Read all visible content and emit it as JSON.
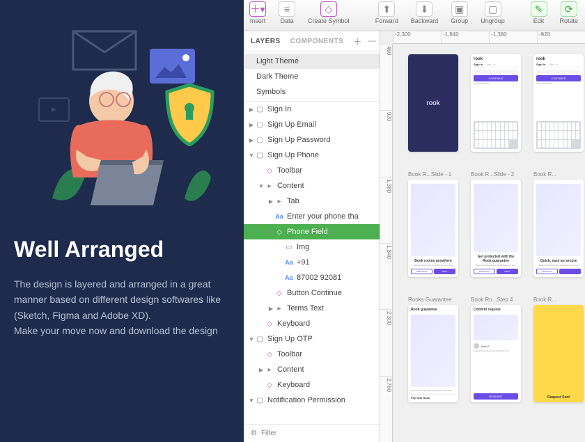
{
  "promo": {
    "title": "Well Arranged",
    "description": "The design is layered and arranged in a great manner based on different design softwares like (Sketch, Figma and Adobe XD).\nMake your move now and download the design"
  },
  "toolbar": {
    "insert": "Insert",
    "data": "Data",
    "create_symbol": "Create Symbol",
    "forward": "Forward",
    "backward": "Backward",
    "group": "Group",
    "ungroup": "Ungroup",
    "edit": "Edit",
    "rotate": "Rotate"
  },
  "panel": {
    "tab_layers": "LAYERS",
    "tab_components": "COMPONENTS",
    "themes": [
      "Light Theme",
      "Dark Theme",
      "Symbols"
    ],
    "filter": "Filter"
  },
  "tree": [
    {
      "d": 0,
      "arr": "▶",
      "ico": "artboard",
      "t": "Sign In"
    },
    {
      "d": 0,
      "arr": "▶",
      "ico": "artboard",
      "t": "Sign Up Email"
    },
    {
      "d": 0,
      "arr": "▶",
      "ico": "artboard",
      "t": "Sign Up Password"
    },
    {
      "d": 0,
      "arr": "▼",
      "ico": "artboard",
      "t": "Sign Up Phone"
    },
    {
      "d": 1,
      "arr": "",
      "ico": "sym",
      "t": "Toolbar"
    },
    {
      "d": 1,
      "arr": "▼",
      "ico": "folder",
      "t": "Content"
    },
    {
      "d": 2,
      "arr": "▶",
      "ico": "folder",
      "t": "Tab"
    },
    {
      "d": 2,
      "arr": "",
      "ico": "txt",
      "t": "Enter your phone tha"
    },
    {
      "d": 2,
      "arr": "▼",
      "ico": "sym",
      "t": "Phone Field",
      "sel": true
    },
    {
      "d": 3,
      "arr": "",
      "ico": "img",
      "t": "Img"
    },
    {
      "d": 3,
      "arr": "",
      "ico": "txt",
      "t": "+91"
    },
    {
      "d": 3,
      "arr": "",
      "ico": "txt",
      "t": "87002 92081"
    },
    {
      "d": 2,
      "arr": "",
      "ico": "sym",
      "t": "Button Continue"
    },
    {
      "d": 2,
      "arr": "▶",
      "ico": "folder",
      "t": "Terms Text"
    },
    {
      "d": 1,
      "arr": "",
      "ico": "sym",
      "t": "Keyboard"
    },
    {
      "d": 0,
      "arr": "▼",
      "ico": "artboard",
      "t": "Sign Up OTP"
    },
    {
      "d": 1,
      "arr": "",
      "ico": "sym",
      "t": "Toolbar"
    },
    {
      "d": 1,
      "arr": "▶",
      "ico": "folder",
      "t": "Content"
    },
    {
      "d": 1,
      "arr": "",
      "ico": "sym",
      "t": "Keyboard"
    },
    {
      "d": 0,
      "arr": "▼",
      "ico": "artboard",
      "t": "Notification Permission"
    }
  ],
  "rulerH": [
    "-2,300",
    "-1,840",
    "-1,380",
    "-920"
  ],
  "rulerV": [
    "460",
    "920",
    "1,380",
    "1,840",
    "2,300",
    "2,760"
  ],
  "artboards": {
    "row1": [
      {
        "label": "",
        "type": "dark",
        "text": "rook"
      },
      {
        "label": "",
        "type": "signin",
        "brand": "rook",
        "tab1": "Sign In",
        "tab2": "Sign Up",
        "btn": "CONTINUE"
      },
      {
        "label": "",
        "type": "signin",
        "brand": "rook",
        "tab1": "Sign In",
        "tab2": "Sign Up",
        "btn": "CONTINUE"
      }
    ],
    "row2": [
      {
        "label": "Book R...Slide - 1",
        "type": "onboard",
        "head": "Book rooms anywhere",
        "prev": "PREVIOUS",
        "next": "NEXT"
      },
      {
        "label": "Book R...Slide - 2",
        "type": "onboard",
        "head": "Get protected with the Rook guarantee",
        "prev": "PREVIOUS",
        "next": "NEXT"
      },
      {
        "label": "Book R...",
        "type": "onboard",
        "head": "Quick, easy an secure",
        "prev": "PREVIOUS",
        "next": ""
      }
    ],
    "row3": [
      {
        "label": "Rooks Guarantee",
        "type": "guarantee",
        "head": "Rook guarantee",
        "foot": "Pay with Rook"
      },
      {
        "label": "Book Ro...Step 4",
        "type": "confirm",
        "head": "Confirm request",
        "name": "Jude D"
      },
      {
        "label": "Book R...",
        "type": "yellow",
        "head": "Request Sent"
      }
    ]
  }
}
